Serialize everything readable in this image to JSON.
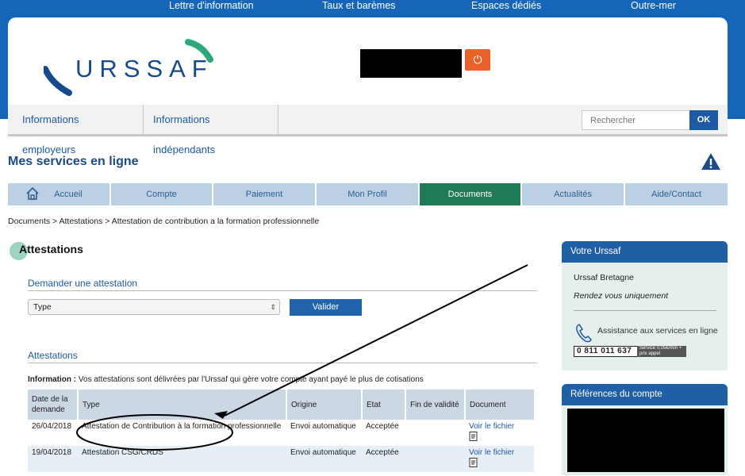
{
  "topnav": [
    "Lettre d'information",
    "Taux et barèmes",
    "Espaces dédiés",
    "Outre-mer"
  ],
  "header": {
    "logo_text": "URSSAF",
    "power_icon": "power-icon"
  },
  "subnav": {
    "items": [
      "Informations employeurs",
      "Informations indépendants"
    ],
    "search_placeholder": "Rechercher",
    "search_button": "OK"
  },
  "page": {
    "title": "Mes services en ligne",
    "alert_icon": "warning-icon"
  },
  "tabs": [
    {
      "label": "Accueil",
      "icon": "home-icon"
    },
    {
      "label": "Compte"
    },
    {
      "label": "Paiement"
    },
    {
      "label": "Mon Profil"
    },
    {
      "label": "Documents",
      "active": true
    },
    {
      "label": "Actualités"
    },
    {
      "label": "Aide/Contact"
    }
  ],
  "breadcrumb": "Documents > Attestations > Attestation de contribution a la formation professionnelle",
  "main": {
    "section_title": "Attestations",
    "request_heading": "Demander une attestation",
    "select_value": "Type",
    "submit_label": "Valider",
    "list_heading": "Attestations",
    "info_label": "Information :",
    "info_text": " Vos attestations sont délivrées par l'Urssaf qui gère votre compte ayant payé le plus de cotisations",
    "table": {
      "headers": [
        "Date de la demande",
        "Type",
        "Origine",
        "Etat",
        "Fin de validité",
        "Document"
      ],
      "rows": [
        {
          "date": "26/04/2018",
          "type": "Attestation de Contribution à la formation professionnelle",
          "origine": "Envoi automatique",
          "etat": "Acceptée",
          "fin": "",
          "doc": "Voir le fichier"
        },
        {
          "date": "19/04/2018",
          "type": "Attestation CSG/CRDS",
          "origine": "Envoi automatique",
          "etat": "Acceptée",
          "fin": "",
          "doc": "Voir le fichier"
        }
      ]
    }
  },
  "sidebar": {
    "votre_urssaf": {
      "title": "Votre Urssaf",
      "name": "Urssaf Bretagne",
      "note": "Rendez vous uniquement",
      "assist": "Assistance aux services en ligne",
      "phone": "0 811 011 637",
      "phone_tag": "Service 0,05€/min + prix appel"
    },
    "references": {
      "title": "Références du compte"
    }
  },
  "colors": {
    "brand_blue": "#1565b8",
    "active_tab": "#1f7a55",
    "power_orange": "#e8622a"
  }
}
